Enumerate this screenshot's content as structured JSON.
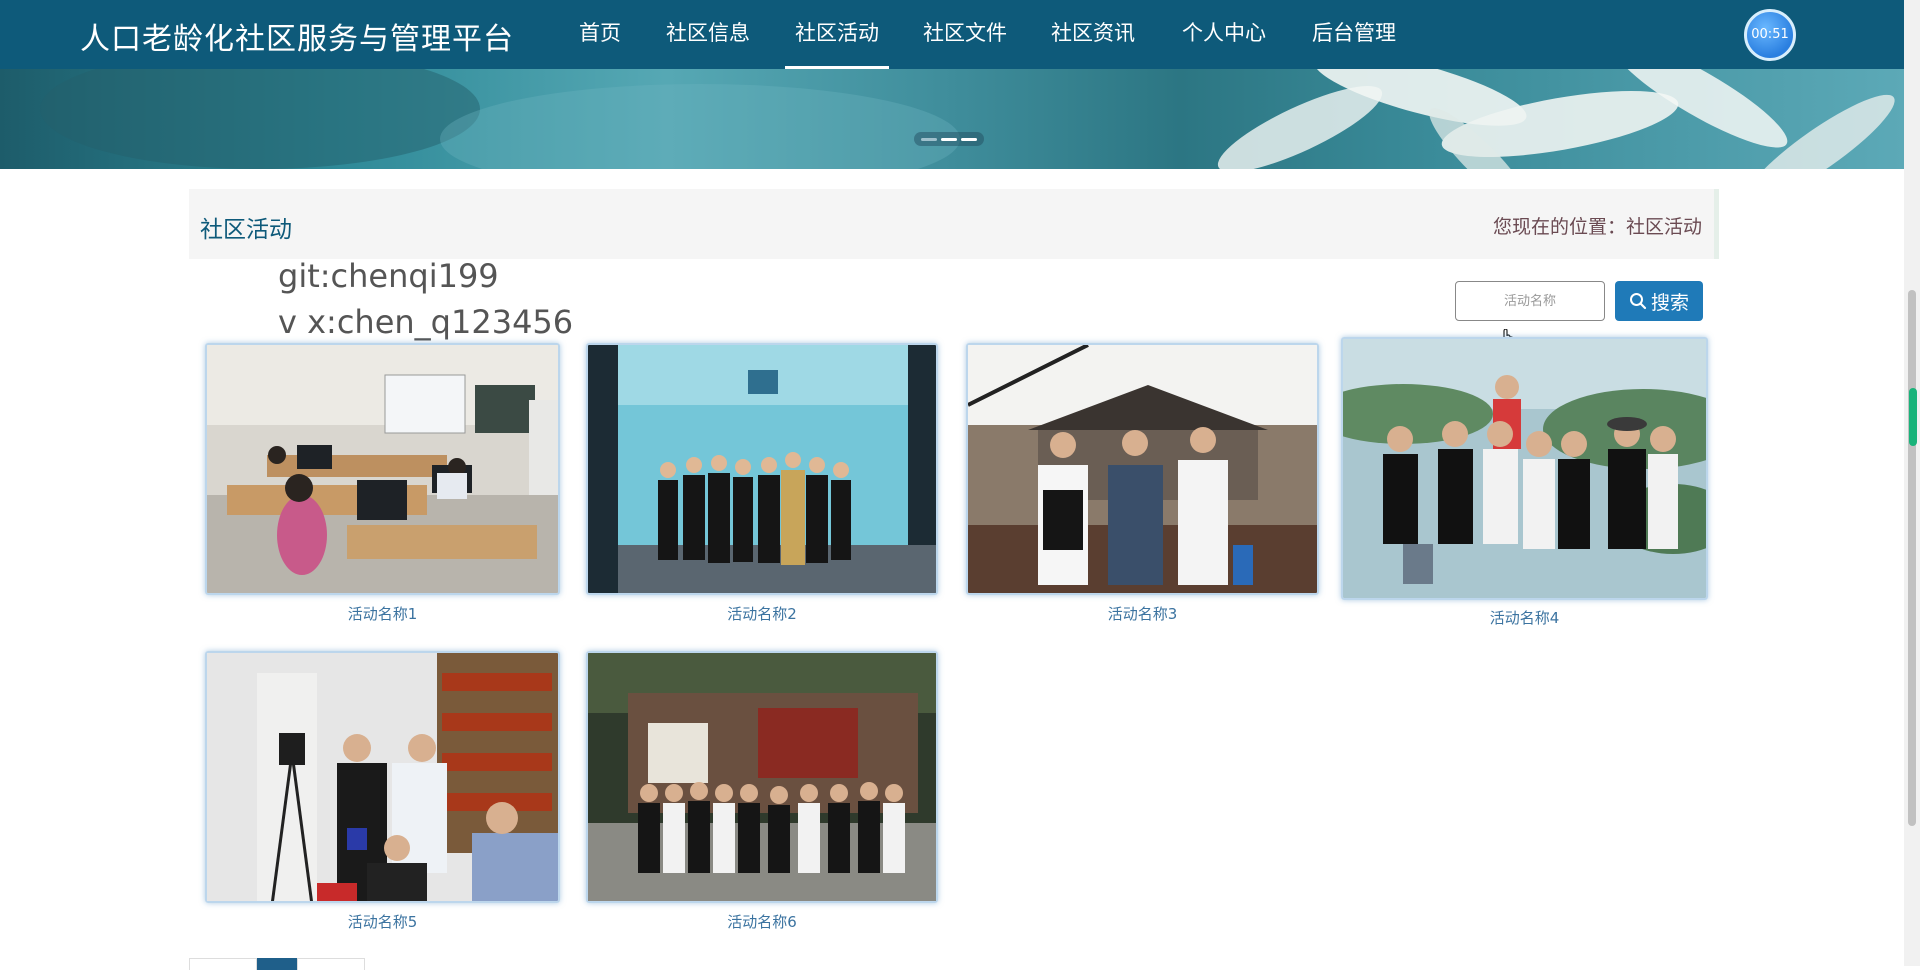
{
  "app": {
    "title": "人口老龄化社区服务与管理平台"
  },
  "nav": {
    "items": [
      {
        "label": "首页"
      },
      {
        "label": "社区信息"
      },
      {
        "label": "社区活动",
        "active": true
      },
      {
        "label": "社区文件"
      },
      {
        "label": "社区资讯"
      },
      {
        "label": "个人中心"
      },
      {
        "label": "后台管理"
      }
    ],
    "timer": "00:51"
  },
  "banner": {
    "slides": 3,
    "active_slide": 1
  },
  "section": {
    "title": "社区活动",
    "breadcrumb": "您现在的位置：社区活动"
  },
  "watermark": {
    "line1": "git:chenqi199",
    "line2": "v x:chen_q123456"
  },
  "search": {
    "placeholder": "活动名称",
    "button_label": "搜索"
  },
  "activities": [
    {
      "name": "活动名称1"
    },
    {
      "name": "活动名称2"
    },
    {
      "name": "活动名称3"
    },
    {
      "name": "活动名称4"
    },
    {
      "name": "活动名称5"
    },
    {
      "name": "活动名称6"
    }
  ],
  "colors": {
    "navbar": "#0e5a7a",
    "accent": "#1f7ab8",
    "caption": "#3b73a0"
  }
}
